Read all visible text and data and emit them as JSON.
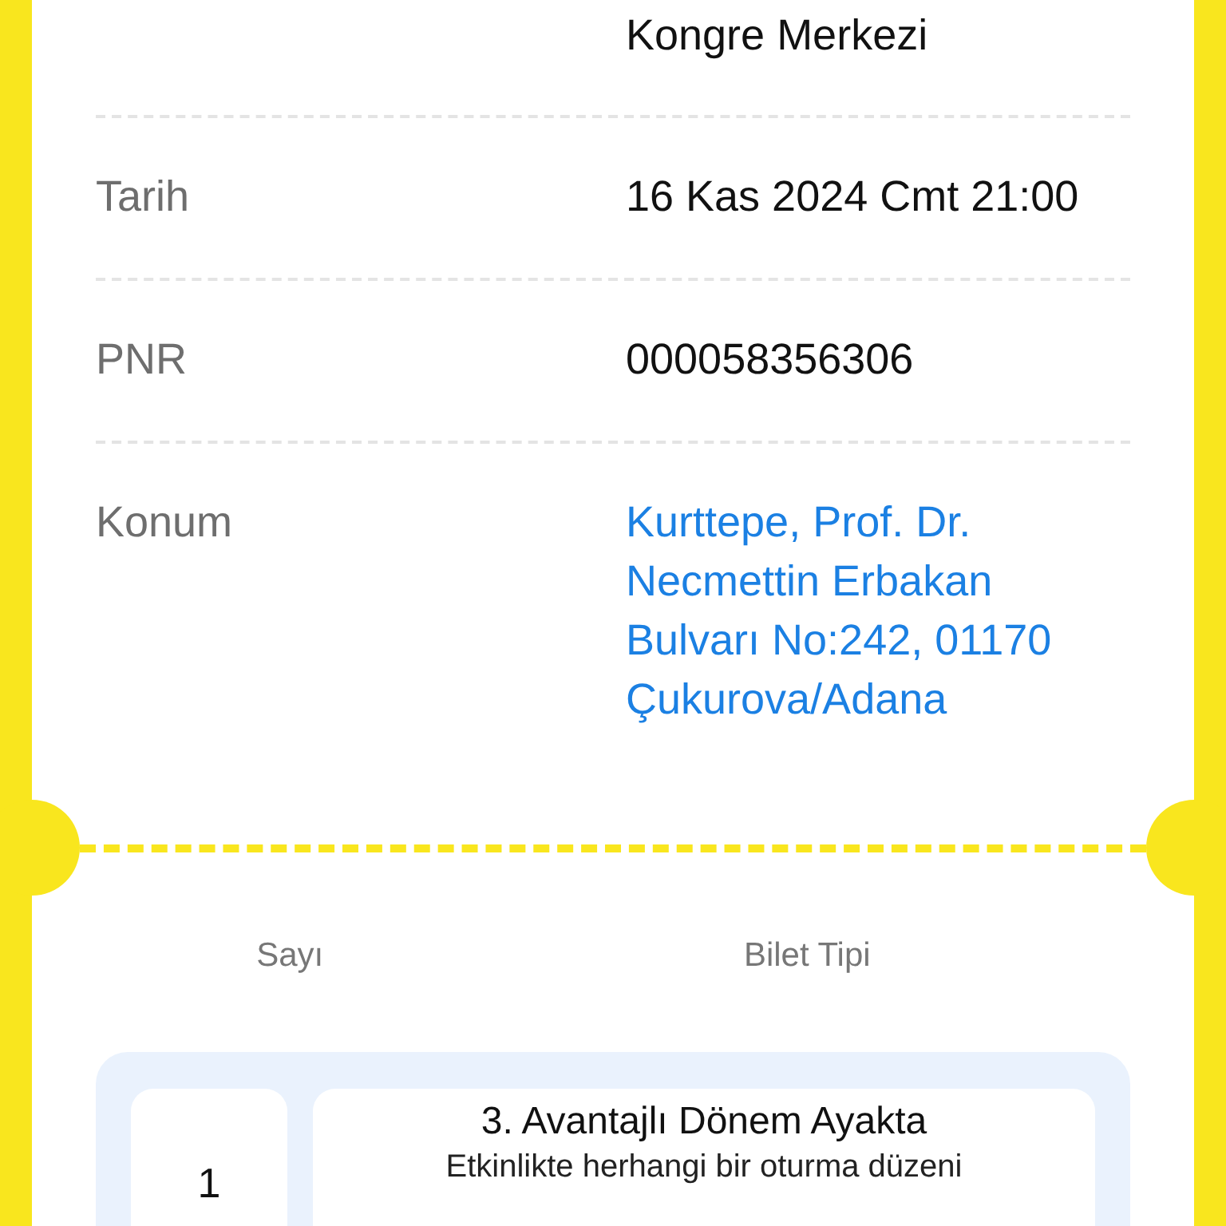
{
  "details": [
    {
      "kind": "text",
      "value": "Kongre Merkezi"
    },
    {
      "kind": "text",
      "label": "Tarih",
      "value": "16 Kas 2024 Cmt 21:00"
    },
    {
      "kind": "text",
      "label": "PNR",
      "value": "000058356306"
    },
    {
      "kind": "link",
      "label": "Konum",
      "value": "Kurttepe, Prof. Dr. Necmettin Erbakan Bulvarı No:242, 01170 Çukurova/Adana"
    }
  ],
  "tickets": {
    "columns": [
      "Sayı",
      "Bilet Tipi"
    ],
    "rows": [
      {
        "count": "1",
        "title": "3. Avantajlı Dönem Ayakta",
        "description": "Etkinlikte herhangi bir oturma düzeni"
      }
    ]
  }
}
